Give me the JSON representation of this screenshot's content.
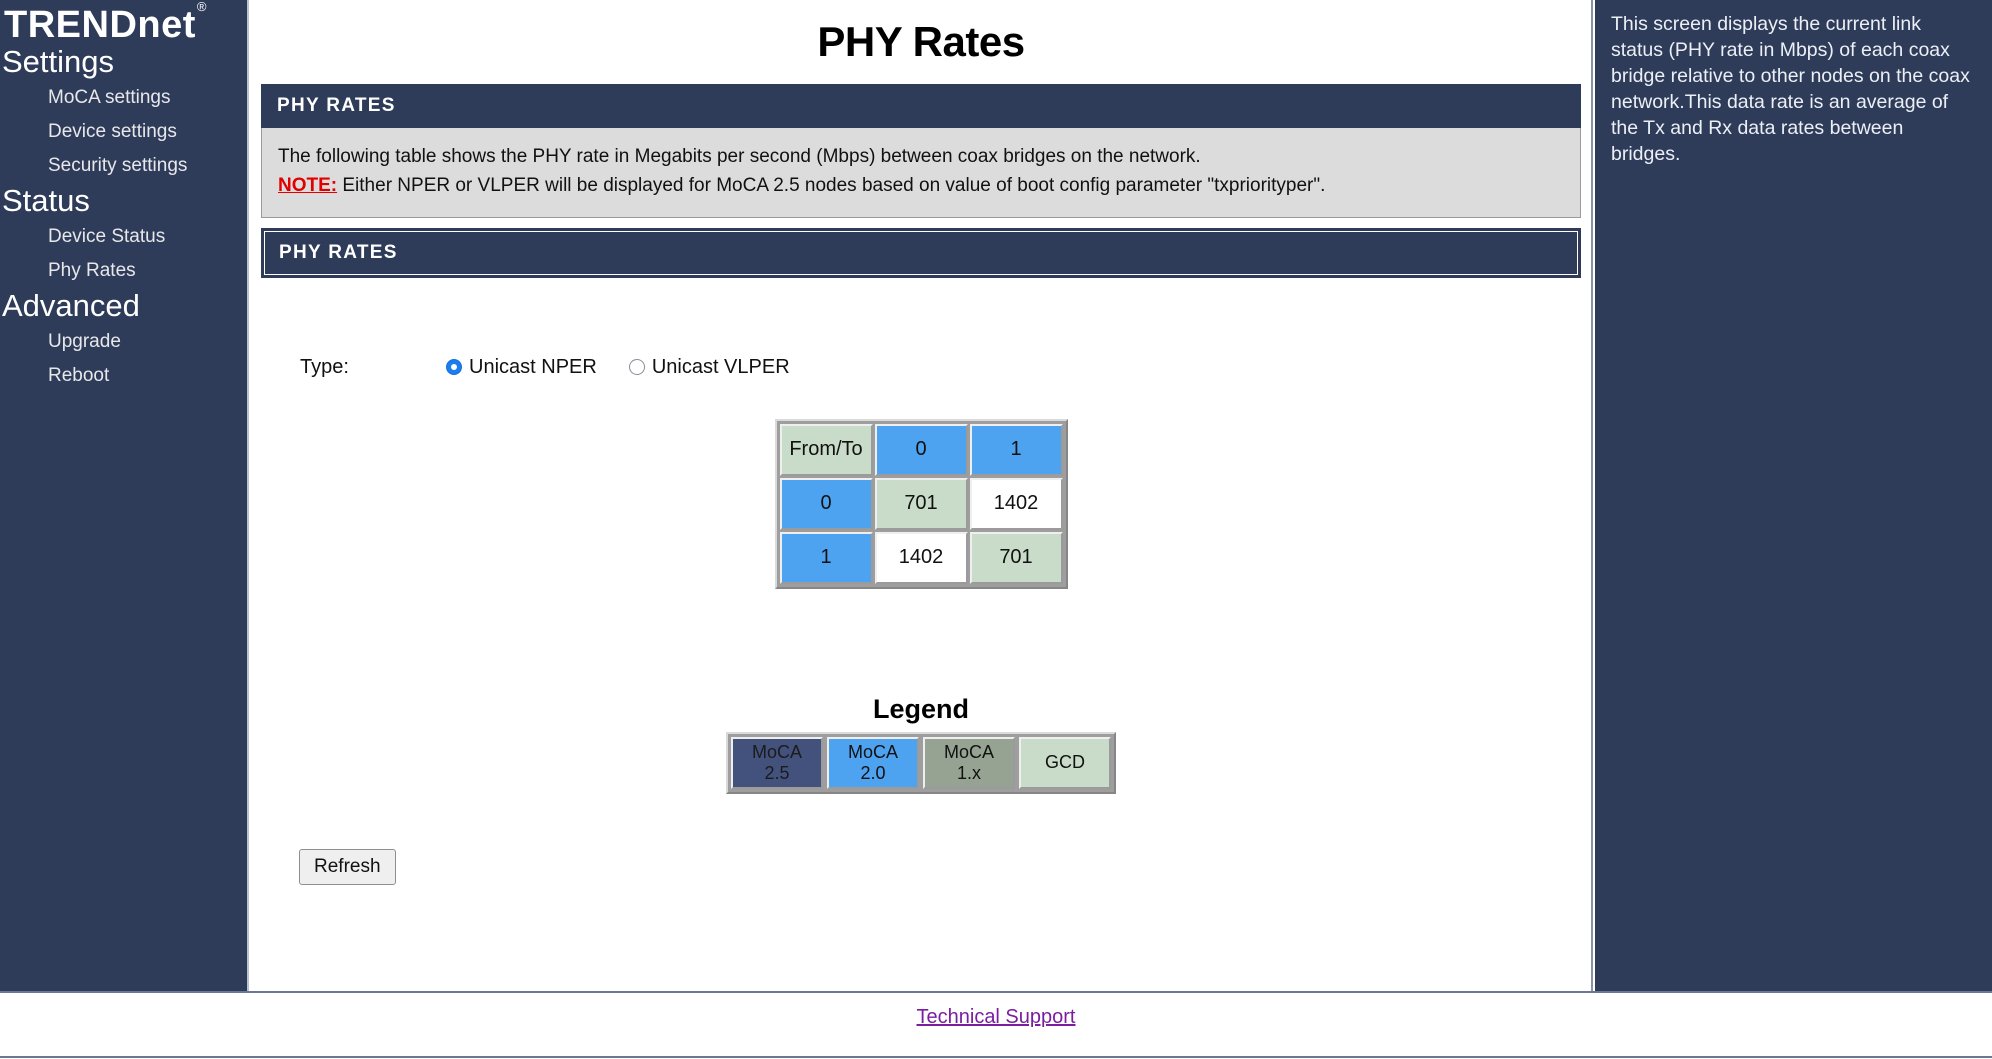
{
  "brand": {
    "name": "TRENDnet",
    "registered": "®"
  },
  "sidebar": {
    "groups": [
      {
        "label": "Settings",
        "items": [
          {
            "label": "MoCA settings"
          },
          {
            "label": "Device settings"
          },
          {
            "label": "Security settings"
          }
        ]
      },
      {
        "label": "Status",
        "items": [
          {
            "label": "Device Status"
          },
          {
            "label": "Phy Rates"
          }
        ]
      },
      {
        "label": "Advanced",
        "items": [
          {
            "label": "Upgrade"
          },
          {
            "label": "Reboot"
          }
        ]
      }
    ]
  },
  "header": {
    "title": "PHY Rates"
  },
  "info_panel": {
    "heading": "PHY RATES",
    "line1": "The following table shows the PHY rate in Megabits per second (Mbps) between coax bridges on the network.",
    "note_label": "NOTE:",
    "note_text": " Either NPER or VLPER will be displayed for MoCA 2.5 nodes based on value of boot config parameter \"txpriorityper\"."
  },
  "rates_panel": {
    "heading": "PHY RATES"
  },
  "type_selector": {
    "label": "Type:",
    "options": [
      {
        "label": "Unicast NPER",
        "selected": true
      },
      {
        "label": "Unicast VLPER",
        "selected": false
      }
    ]
  },
  "chart_data": {
    "type": "table",
    "title": "PHY Rates matrix (Mbps)",
    "corner_label": "From/To",
    "columns": [
      "0",
      "1"
    ],
    "rows": [
      "0",
      "1"
    ],
    "values": [
      [
        "701",
        "1402"
      ],
      [
        "1402",
        "701"
      ]
    ],
    "cell_classes": [
      [
        "c-gcd",
        "c-white"
      ],
      [
        "c-white",
        "c-gcd"
      ]
    ],
    "header_class": "c-moca2",
    "corner_class": "c-gcd"
  },
  "legend": {
    "title": "Legend",
    "items": [
      {
        "line1": "MoCA",
        "line2": "2.5",
        "color": "#43527d",
        "class": "l-moca25"
      },
      {
        "line1": "MoCA",
        "line2": "2.0",
        "color": "#4ea3f0",
        "class": "l-moca20"
      },
      {
        "line1": "MoCA",
        "line2": "1.x",
        "color": "#97a392",
        "class": "l-moca1x"
      },
      {
        "line1": "GCD",
        "line2": "",
        "color": "#c9dcc9",
        "class": "l-gcd"
      }
    ]
  },
  "actions": {
    "refresh_label": "Refresh"
  },
  "help": {
    "text": "This screen displays the current link status (PHY rate in Mbps) of each coax bridge relative to other nodes on the coax network.This data rate is an average of the Tx and Rx data rates between bridges."
  },
  "footer": {
    "link_label": "Technical Support"
  },
  "colors": {
    "navy": "#2e3c5a",
    "moca25": "#43527d",
    "moca20": "#4ea3f0",
    "moca1x": "#97a392",
    "gcd": "#c9dcc9",
    "note_red": "#e30000",
    "link_purple": "#7a1ea1"
  }
}
